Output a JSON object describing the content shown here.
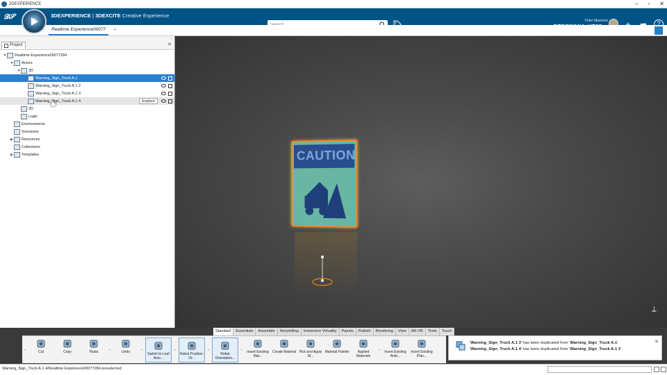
{
  "window": {
    "title": "3DEXPERIENCE",
    "controls": [
      "–",
      "▫",
      "✕"
    ]
  },
  "header": {
    "brand_bold": "3DEXPERIENCE",
    "brand_sep": " | ",
    "brand_app": "3DEXCITE",
    "brand_sub": " Creative Experience",
    "search_placeholder": "Search",
    "user_name": "Peter Maverick",
    "credential": "DEBSWANA_VR03",
    "icons": [
      "compass-icon",
      "tag-icon",
      "add-icon",
      "share-icon",
      "help-icon"
    ]
  },
  "tabs": {
    "main": "Realtime Experience00077",
    "add": "+"
  },
  "panel": {
    "tab_label": "Project",
    "close": "✕",
    "tree": [
      {
        "label": "Realtime Experience00077284",
        "indent": 0,
        "expander": "▼"
      },
      {
        "label": "Actors",
        "indent": 1,
        "expander": "▼"
      },
      {
        "label": "3D",
        "indent": 2,
        "expander": "▼"
      },
      {
        "label": "Warning_Sign_Truck A.1",
        "indent": 3,
        "expander": "",
        "state": "selected"
      },
      {
        "label": "Warning_Sign_Truck A.1 2",
        "indent": 3,
        "expander": ""
      },
      {
        "label": "Warning_Sign_Truck A.1 3",
        "indent": 3,
        "expander": ""
      },
      {
        "label": "Warning_Sign_Truck A.1 4",
        "indent": 3,
        "expander": "",
        "state": "hover"
      },
      {
        "label": "2D",
        "indent": 2,
        "expander": ""
      },
      {
        "label": "Logic",
        "indent": 2,
        "expander": ""
      },
      {
        "label": "Environments",
        "indent": 1,
        "expander": ""
      },
      {
        "label": "Scenarios",
        "indent": 1,
        "expander": ""
      },
      {
        "label": "Resources",
        "indent": 1,
        "expander": "▶"
      },
      {
        "label": "Collections",
        "indent": 1,
        "expander": ""
      },
      {
        "label": "Templates",
        "indent": 1,
        "expander": "▶"
      }
    ],
    "explore_label": "Explore"
  },
  "viewport": {
    "sign_text": "CAUTION"
  },
  "ribbon": {
    "tabs": [
      "Standard",
      "Essentials",
      "Assemble",
      "Storytelling",
      "Immersive Virtuality",
      "Panels",
      "Publish",
      "Rendering",
      "View",
      "AR-VR",
      "Tools",
      "Touch"
    ],
    "active_tab": "Standard",
    "buttons": [
      {
        "label": "Cut",
        "icon": "scissors-icon"
      },
      {
        "label": "Copy",
        "icon": "copy-icon"
      },
      {
        "label": "Paste",
        "icon": "paste-icon"
      },
      {
        "label": "Undo",
        "icon": "undo-icon"
      },
      {
        "label": "Switch to Leaf Acto...",
        "icon": "switch-leaf-icon"
      },
      {
        "label": "Robot Position: Or...",
        "icon": "robot-position-icon"
      },
      {
        "label": "Robot Orientation...",
        "icon": "robot-orientation-icon"
      },
      {
        "label": "Insert Existing Mat...",
        "icon": "insert-material-icon"
      },
      {
        "label": "Create Material",
        "icon": "create-material-icon"
      },
      {
        "label": "Pick and Apply M...",
        "icon": "pick-apply-icon"
      },
      {
        "label": "Material Palette",
        "icon": "material-palette-icon"
      },
      {
        "label": "Applied Materials",
        "icon": "applied-materials-icon"
      },
      {
        "label": "Insert Existing Amb...",
        "icon": "insert-ambience-icon"
      },
      {
        "label": "Insert Existing Plan...",
        "icon": "insert-planet-icon"
      }
    ]
  },
  "notifications": [
    {
      "pre": "'",
      "a": "Warning_Sign_Truck A.1 3",
      "mid": "' has been duplicated from '",
      "b": "Warning_Sign_Truck A.1",
      "post": "'"
    },
    {
      "pre": "'",
      "a": "Warning_Sign_Truck A.1 4",
      "mid": "' has been duplicated from '",
      "b": "Warning_Sign_Truck A.1 2",
      "post": "'"
    }
  ],
  "status": {
    "text": "Warning_Sign_Truck A.1 4/Realtime Experience00077284 preselected"
  },
  "colors": {
    "header_blue": "#005386",
    "selection_blue": "#2b7fd0",
    "sign_orange": "#f08a24",
    "sign_teal": "#69b7a3"
  }
}
